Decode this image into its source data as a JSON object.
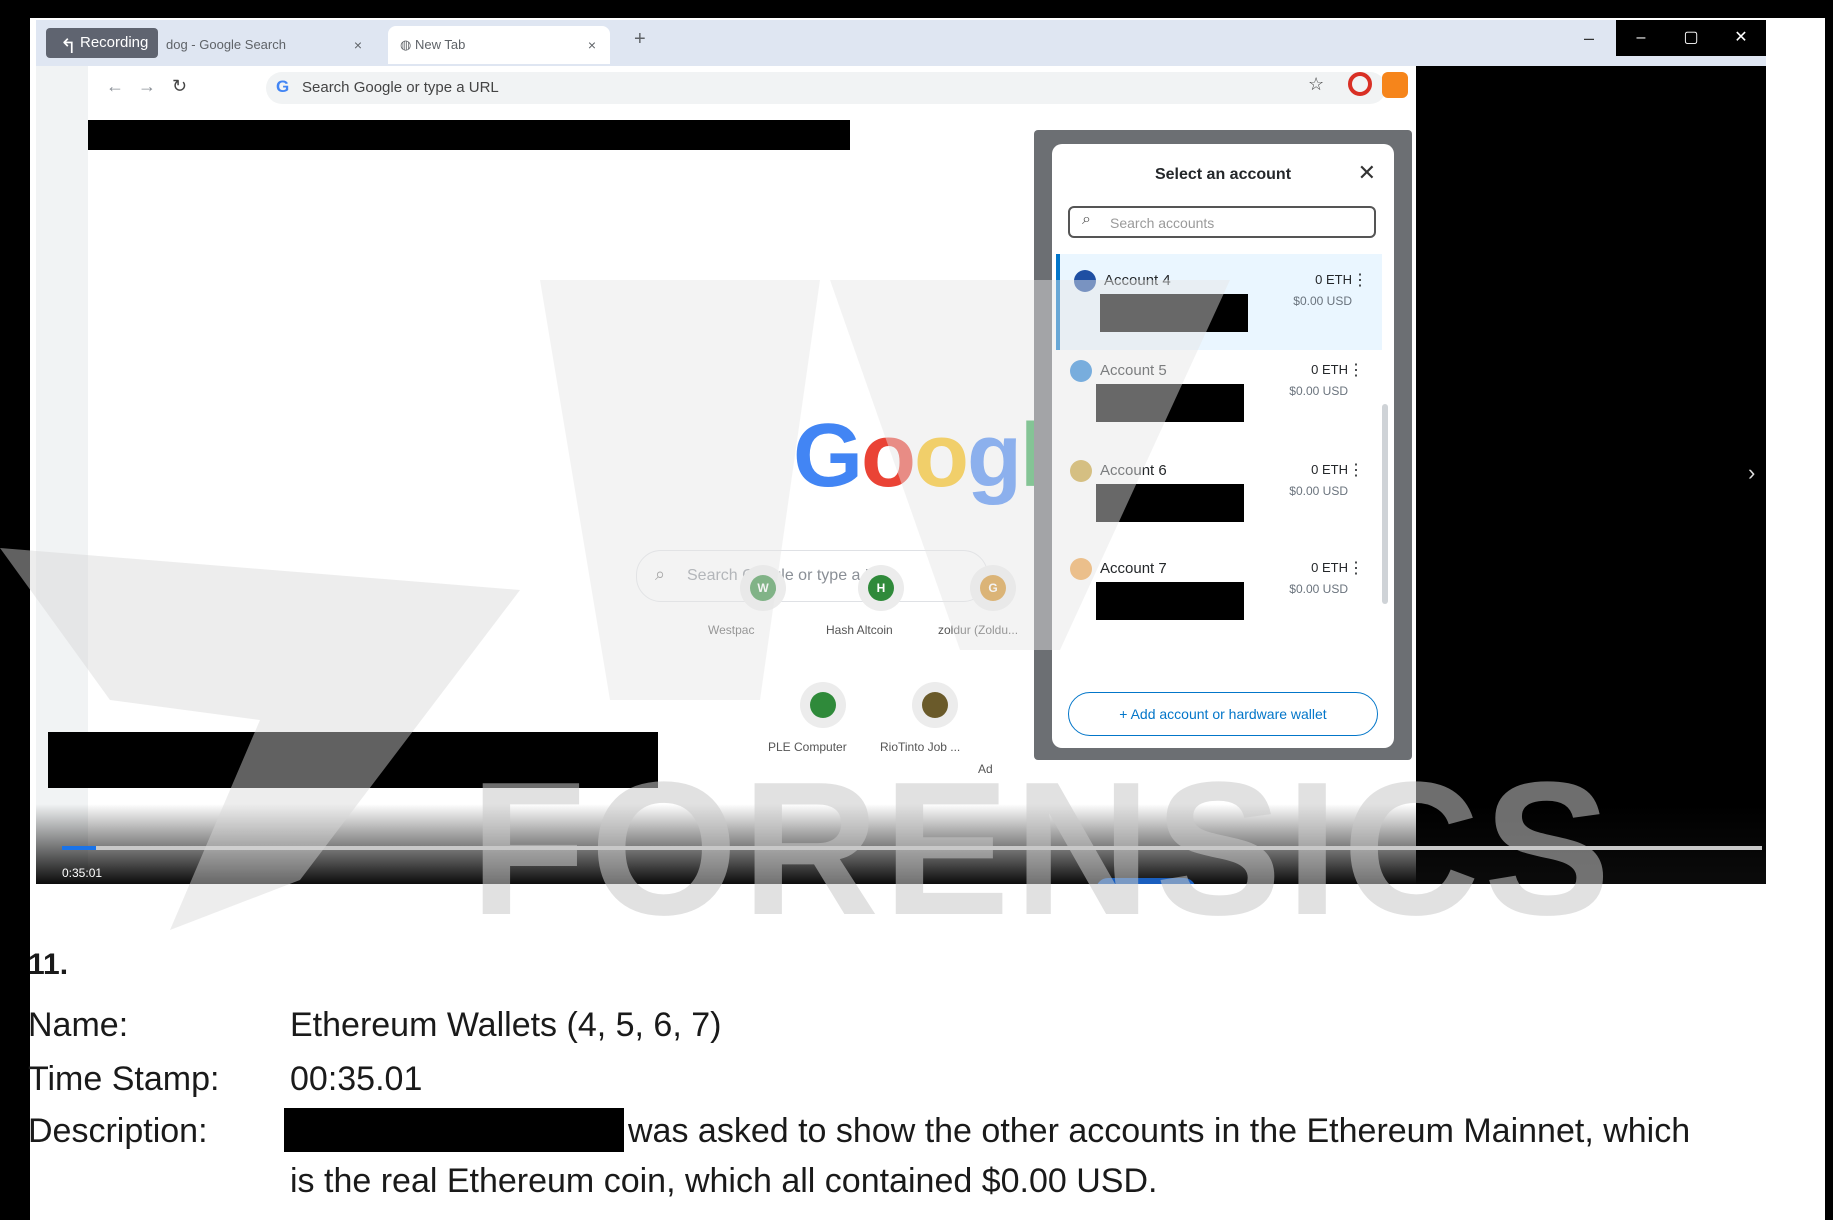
{
  "browser": {
    "recording_label": "Recording",
    "tabs": [
      {
        "label": "dog - Google Search",
        "close": "×"
      },
      {
        "label": "New Tab",
        "close": "×"
      }
    ],
    "new_tab": "+",
    "window_controls": [
      "–",
      "▢",
      "✕"
    ],
    "omnibox_placeholder": "Search Google or type a URL"
  },
  "new_tab_page": {
    "logo": "Googl",
    "search_placeholder": "Search Google or type a URL",
    "shortcuts": [
      {
        "label": "Westpac",
        "letter": "W",
        "color": "#2f8a3a"
      },
      {
        "label": "Hash Altcoin",
        "letter": "H",
        "color": "#2f8a3a"
      },
      {
        "label": "zoldur (Zoldu...",
        "letter": "G",
        "color": "#d38b1c"
      },
      {
        "label": "PLE Computer",
        "letter": "",
        "color": "#2f8a3a"
      },
      {
        "label": "RioTinto Job ...",
        "letter": "",
        "color": "#6a5a2a"
      },
      {
        "label": "Ad",
        "letter": "",
        "color": "#888888"
      }
    ]
  },
  "metamask": {
    "title": "Select an account",
    "search_placeholder": "Search accounts",
    "accounts": [
      {
        "name": "Account 4",
        "eth": "0 ETH",
        "usd": "$0.00 USD",
        "avatar": "#1f4fa3"
      },
      {
        "name": "Account 5",
        "eth": "0 ETH",
        "usd": "$0.00 USD",
        "avatar": "#1d7fd6"
      },
      {
        "name": "Account 6",
        "eth": "0 ETH",
        "usd": "$0.00 USD",
        "avatar": "#c8a030"
      },
      {
        "name": "Account 7",
        "eth": "0 ETH",
        "usd": "$0.00 USD",
        "avatar": "#f0a040"
      }
    ],
    "add_button": "+ Add account or hardware wallet"
  },
  "player": {
    "time": "0:35:01",
    "progress": 0.02
  },
  "watermark": "FORENSICS",
  "record": {
    "number": "11.",
    "name_label": "Name:",
    "name_value": "Ethereum Wallets (4, 5, 6, 7)",
    "time_label": "Time Stamp:",
    "time_value": "00:35.01",
    "desc_label": "Description:",
    "desc_line1": "was asked to show the other accounts in the Ethereum Mainnet, which",
    "desc_line2": "is the real Ethereum coin, which all contained $0.00 USD."
  }
}
